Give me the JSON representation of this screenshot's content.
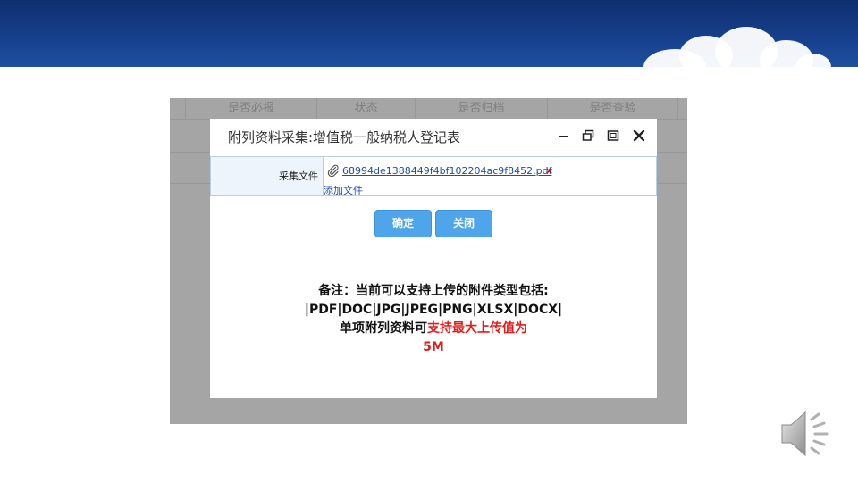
{
  "background_table": {
    "headers": [
      "是否必报",
      "状态",
      "是否归档",
      "是否查验"
    ]
  },
  "dialog": {
    "title": "附列资料采集:增值税一般纳税人登记表",
    "controls": {
      "minimize_icon": "minimize-icon",
      "restore_icon": "restore-icon",
      "maximize_icon": "maximize-icon",
      "close_icon": "close-icon"
    },
    "form": {
      "label": "采集文件",
      "file_name": "68994de1388449f4bf102204ac9f8452.pdf",
      "delete_mark": "×",
      "add_file": "添加文件"
    },
    "buttons": {
      "confirm": "确定",
      "close": "关闭"
    },
    "note": {
      "line1": "备注：当前可以支持上传的附件类型包括:",
      "line2": "|PDF|DOC|JPG|JPEG|PNG|XLSX|DOCX|",
      "line3_prefix": "单项附列资料可",
      "line3_red": "支持最大上传值为",
      "line4_red": "5M"
    }
  },
  "colors": {
    "banner": "#163f8c",
    "button": "#4ea5ea",
    "highlight": "#e31a1a",
    "backdrop": "#a5a5a5"
  },
  "icons": {
    "attachment": "paperclip-icon",
    "audio": "speaker-icon"
  }
}
